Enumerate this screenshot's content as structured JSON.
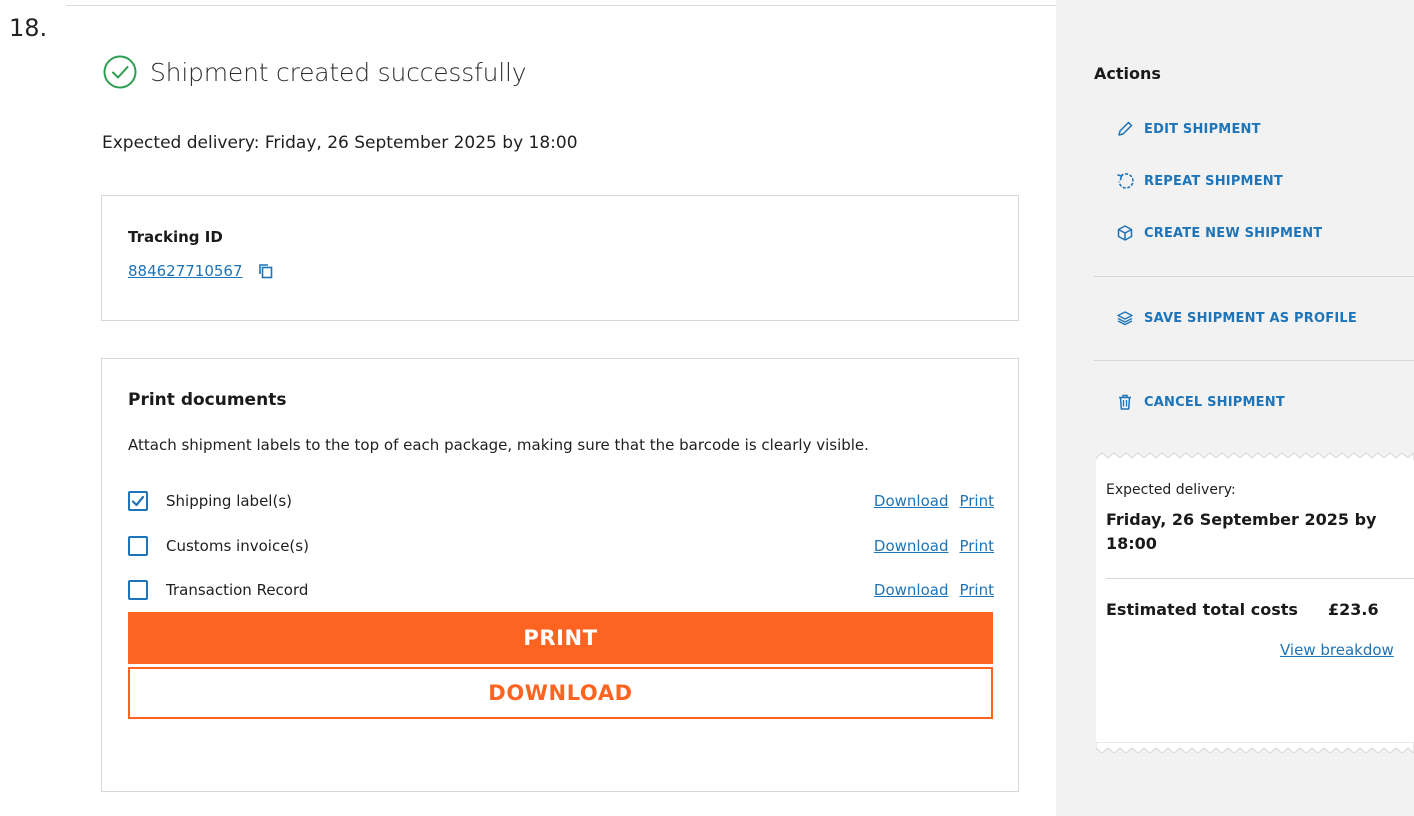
{
  "step_number": "18.",
  "status": {
    "title": "Shipment created successfully",
    "icon": "check-circle-icon",
    "icon_color": "#2e9e4f"
  },
  "expected_delivery_text": "Expected delivery: Friday, 26 September 2025 by 18:00",
  "tracking": {
    "label": "Tracking ID",
    "id": "884627710567",
    "copy_icon": "copy-icon"
  },
  "print_documents": {
    "title": "Print documents",
    "description": "Attach shipment labels to the top of each package, making sure that the barcode is clearly visible.",
    "documents": [
      {
        "label": "Shipping label(s)",
        "checked": true,
        "download": "Download",
        "print": "Print"
      },
      {
        "label": "Customs invoice(s)",
        "checked": false,
        "download": "Download",
        "print": "Print"
      },
      {
        "label": "Transaction Record",
        "checked": false,
        "download": "Download",
        "print": "Print"
      }
    ],
    "print_button": "PRINT",
    "download_button": "DOWNLOAD"
  },
  "actions": {
    "title": "Actions",
    "items": [
      {
        "label": "EDIT SHIPMENT",
        "icon": "pencil-icon"
      },
      {
        "label": "REPEAT SHIPMENT",
        "icon": "repeat-icon"
      },
      {
        "label": "CREATE NEW SHIPMENT",
        "icon": "package-icon"
      },
      {
        "label": "SAVE SHIPMENT AS PROFILE",
        "icon": "layers-icon"
      },
      {
        "label": "CANCEL SHIPMENT",
        "icon": "trash-icon"
      }
    ]
  },
  "summary": {
    "expected_label": "Expected delivery:",
    "expected_date_line1": "Friday, 26 September 2025 by",
    "expected_date_line2": "18:00",
    "costs_label": "Estimated total costs",
    "costs_value": "£23.6",
    "breakdown_link": "View breakdow"
  },
  "colors": {
    "accent_orange": "#fd6421",
    "link_blue": "#1d74b8",
    "sidebar_bg": "#f2f2f2"
  }
}
